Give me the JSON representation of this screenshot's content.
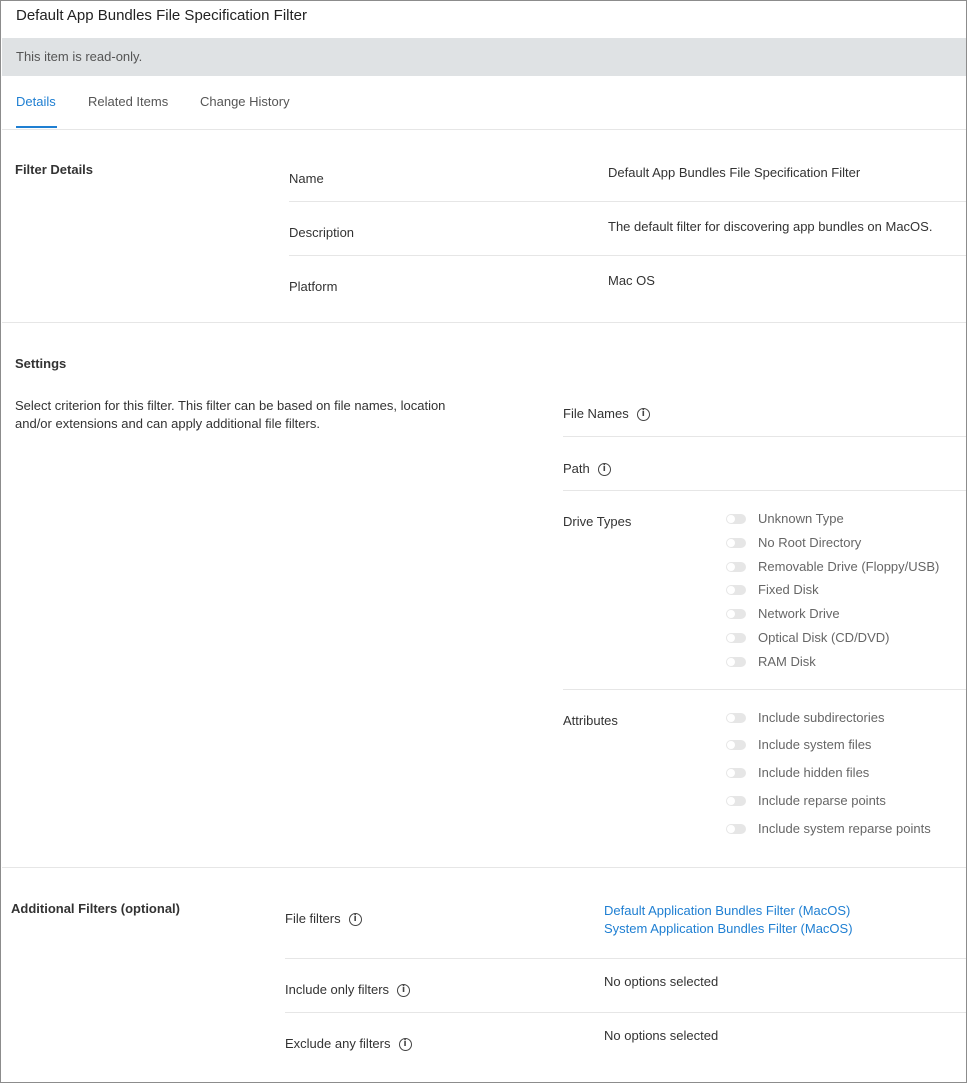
{
  "header": {
    "title": "Default App Bundles File Specification Filter"
  },
  "readonly_notice": "This item is read-only.",
  "tabs": [
    {
      "label": "Details",
      "active": true
    },
    {
      "label": "Related Items",
      "active": false
    },
    {
      "label": "Change History",
      "active": false
    }
  ],
  "filter_details": {
    "title": "Filter Details",
    "rows": [
      {
        "label": "Name",
        "value": "Default App Bundles File Specification Filter"
      },
      {
        "label": "Description",
        "value": "The default filter for discovering app bundles on MacOS."
      },
      {
        "label": "Platform",
        "value": "Mac OS"
      }
    ]
  },
  "settings": {
    "title": "Settings",
    "description": "Select criterion for this filter. This filter can be based on file names, location and/or extensions and can apply additional file filters.",
    "file_names_label": "File Names",
    "path_label": "Path",
    "drive_types_label": "Drive Types",
    "drive_types": [
      "Unknown Type",
      "No Root Directory",
      "Removable Drive (Floppy/USB)",
      "Fixed Disk",
      "Network Drive",
      "Optical Disk (CD/DVD)",
      "RAM Disk"
    ],
    "attributes_label": "Attributes",
    "attributes": [
      "Include subdirectories",
      "Include system files",
      "Include hidden files",
      "Include reparse points",
      "Include system reparse points"
    ]
  },
  "additional_filters": {
    "title": "Additional Filters (optional)",
    "file_filters_label": "File filters",
    "file_filters": [
      "Default Application Bundles Filter (MacOS)",
      "System Application Bundles Filter (MacOS)"
    ],
    "include_only_label": "Include only filters",
    "include_only_value": "No options selected",
    "exclude_any_label": "Exclude any filters",
    "exclude_any_value": "No options selected"
  },
  "icons": {
    "info": "info-circle-icon"
  },
  "colors": {
    "accent": "#1f7fd2",
    "readonly_bar": "#dfe2e4"
  }
}
